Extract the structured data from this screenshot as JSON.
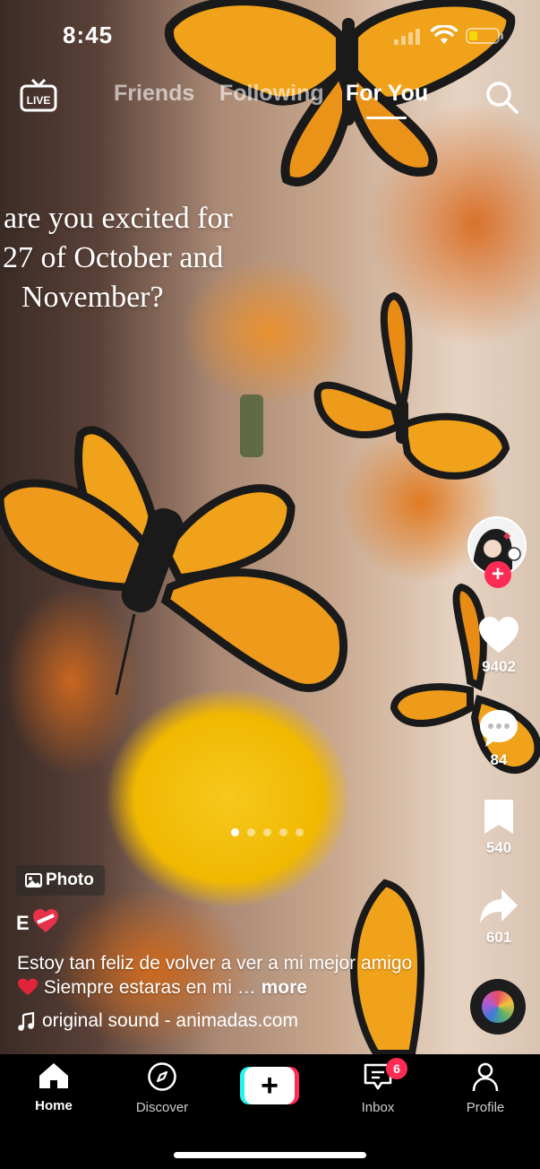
{
  "status_bar": {
    "time": "8:45",
    "battery_fraction": 0.3
  },
  "top_nav": {
    "live_label": "LIVE",
    "tabs": [
      {
        "label": "Friends",
        "active": false
      },
      {
        "label": "Following",
        "active": false
      },
      {
        "label": "For You",
        "active": true
      }
    ]
  },
  "post": {
    "caption_lines": [
      "are you excited for",
      "27 of October and",
      "November?"
    ],
    "likes": "9402",
    "comments": "84",
    "saves": "540",
    "shares": "601",
    "follow_symbol": "+",
    "slide_count": 5,
    "active_slide": 0,
    "photo_badge": "Photo",
    "username": "E",
    "description": "Estoy tan feliz de volver a ver a mi mejor amigo",
    "description_cont": " Siempre estaras en mi … ",
    "more_label": "more",
    "sound": "original sound - animadas.com"
  },
  "bottom_nav": {
    "home": "Home",
    "discover": "Discover",
    "create_symbol": "+",
    "inbox": "Inbox",
    "inbox_badge": "6",
    "profile": "Profile"
  },
  "colors": {
    "accent": "#fe2c55",
    "create_left": "#25f4ee",
    "battery": "#f5d90a"
  }
}
